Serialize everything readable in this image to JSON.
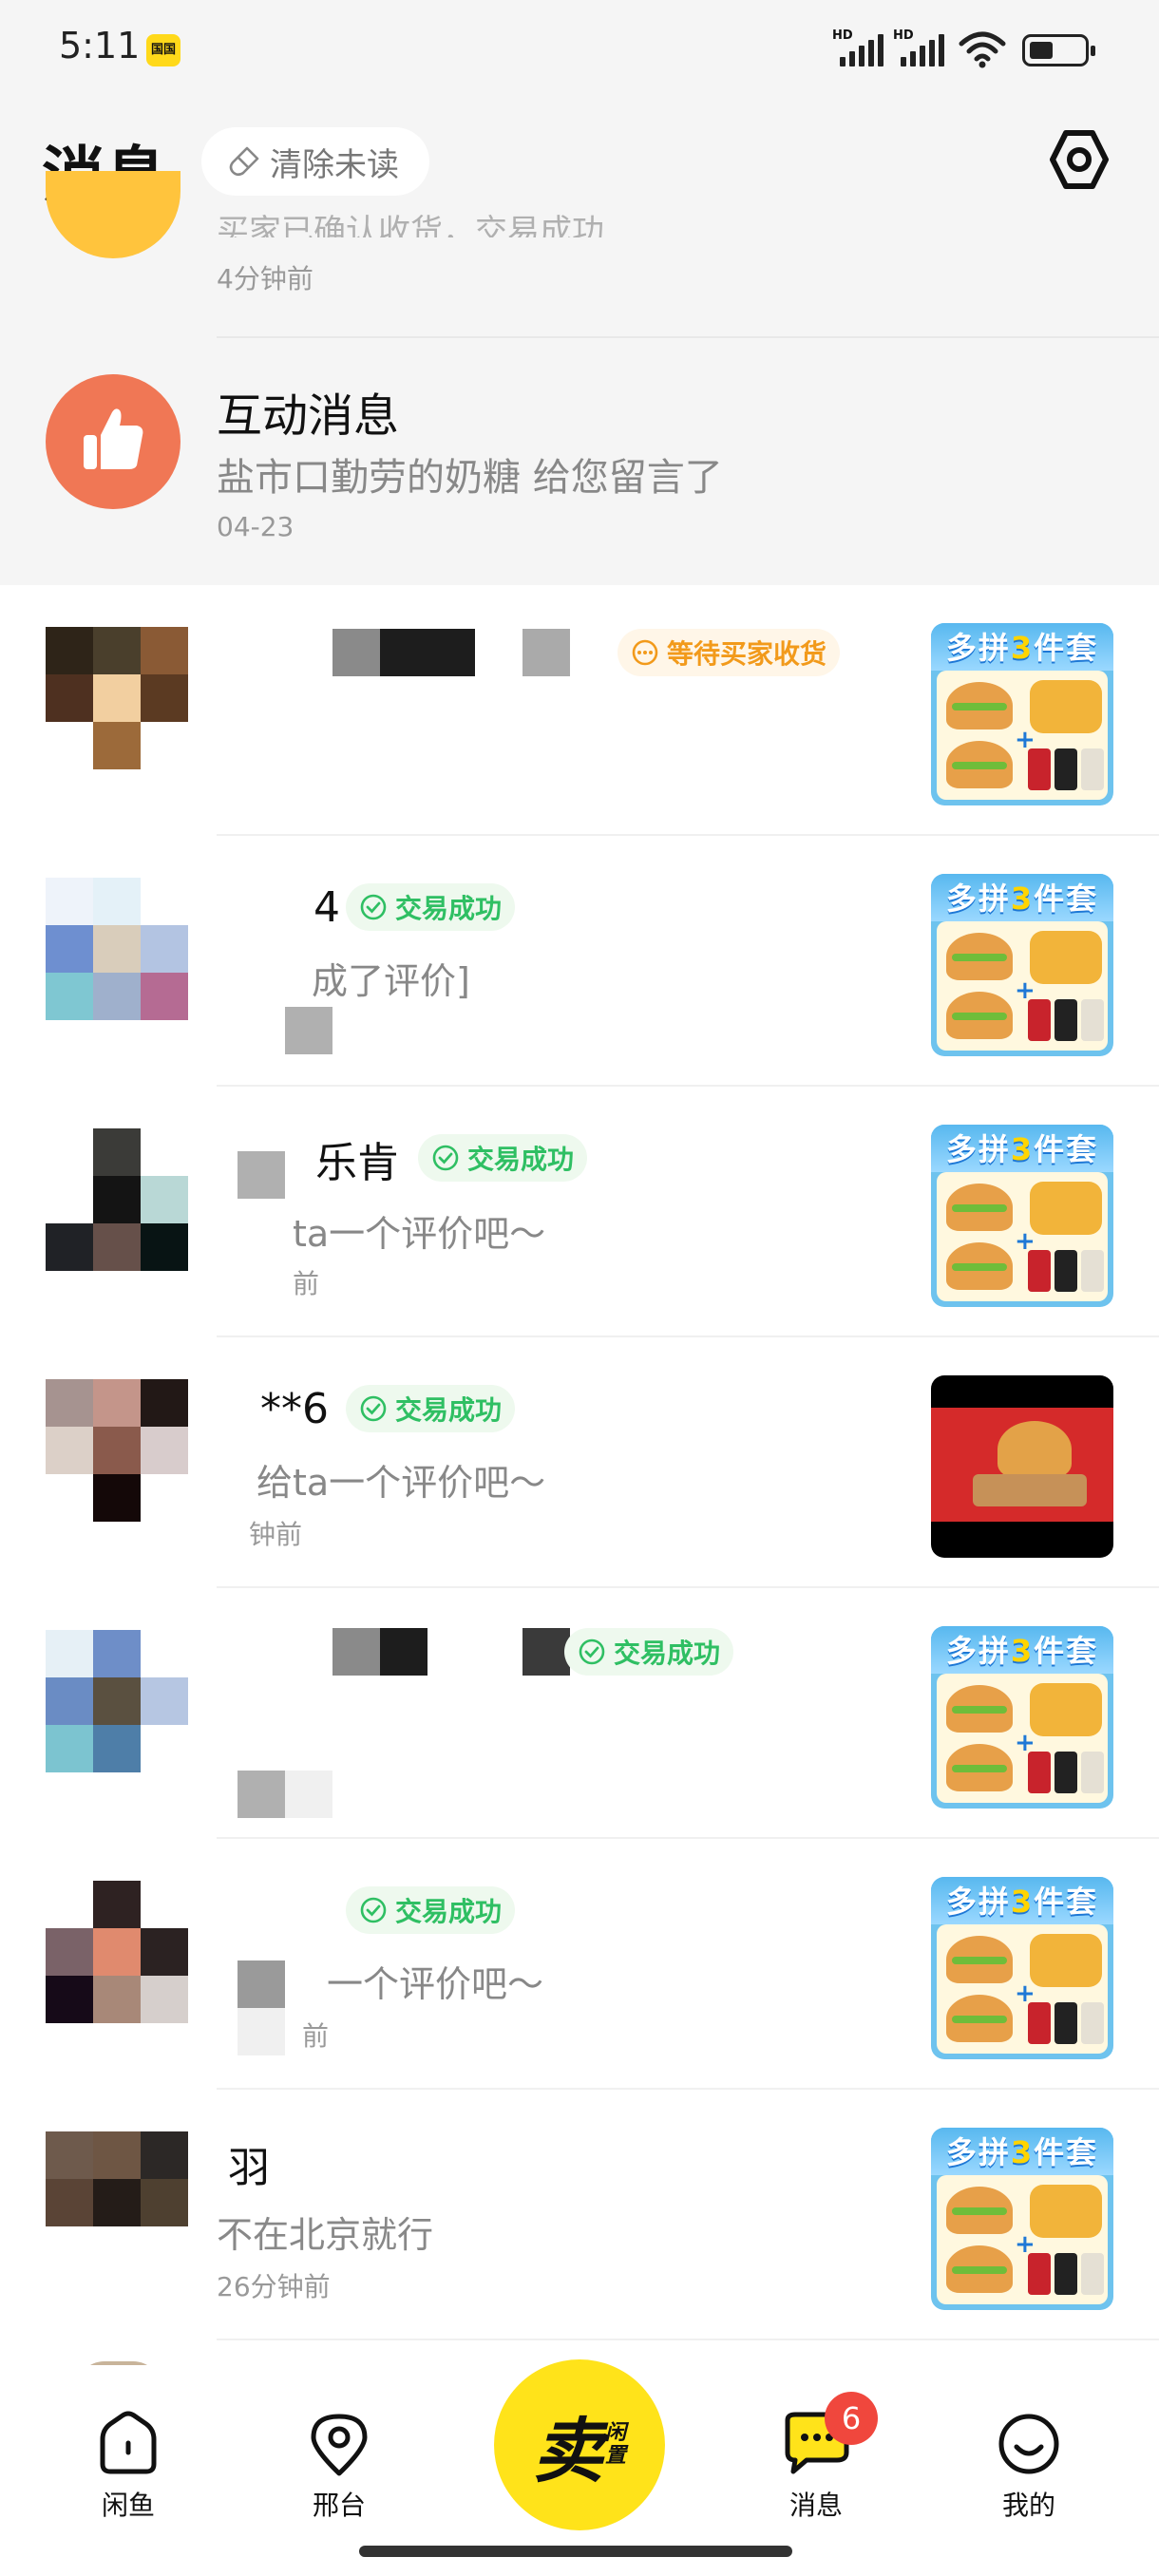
{
  "status_bar": {
    "time": "5:11",
    "calendar_badge": "国国",
    "hd_label": "HD",
    "battery": "low"
  },
  "header": {
    "title": "消息",
    "clear_unread": "清除未读"
  },
  "partial_item": {
    "preview": "买家已确认收货，交易成功",
    "time": "4分钟前"
  },
  "interaction": {
    "title": "互动消息",
    "preview": "盐市口勤劳的奶糖 给您留言了",
    "date": "04-23"
  },
  "conversations": [
    {
      "status": "等待买家收货",
      "status_type": "pending",
      "name": "",
      "preview": "",
      "time": "",
      "product": "多拼3件套"
    },
    {
      "status": "交易成功",
      "status_type": "success",
      "name": "4",
      "preview": "成了评价]",
      "time": "",
      "product": "多拼3件套"
    },
    {
      "status": "交易成功",
      "status_type": "success",
      "name": "乐肯",
      "preview": "ta一个评价吧～",
      "time": "前",
      "product": "多拼3件套"
    },
    {
      "status": "交易成功",
      "status_type": "success",
      "name": "**6",
      "preview": "给ta一个评价吧～",
      "time": "钟前",
      "product": "burger-photo"
    },
    {
      "status": "交易成功",
      "status_type": "success",
      "name": "",
      "preview": "",
      "time": "",
      "product": "多拼3件套"
    },
    {
      "status": "交易成功",
      "status_type": "success",
      "name": "",
      "preview": "一个评价吧～",
      "time": "前",
      "product": "多拼3件套"
    },
    {
      "status": "",
      "status_type": "none",
      "name": "羽",
      "preview": "不在北京就行",
      "time": "26分钟前",
      "product": "多拼3件套"
    }
  ],
  "product_banner": {
    "pre": "多拼",
    "num": "3",
    "post": "件套"
  },
  "nav": {
    "home": "闲鱼",
    "platform": "邢台",
    "sell_big": "卖",
    "sell_small_1": "闲",
    "sell_small_2": "置",
    "messages": "消息",
    "messages_count": "6",
    "mine": "我的"
  },
  "colors": {
    "accent_yellow": "#ffe31a",
    "success_green": "#2fbf63",
    "pending_orange": "#f29a1b",
    "badge_red": "#f0473d"
  }
}
